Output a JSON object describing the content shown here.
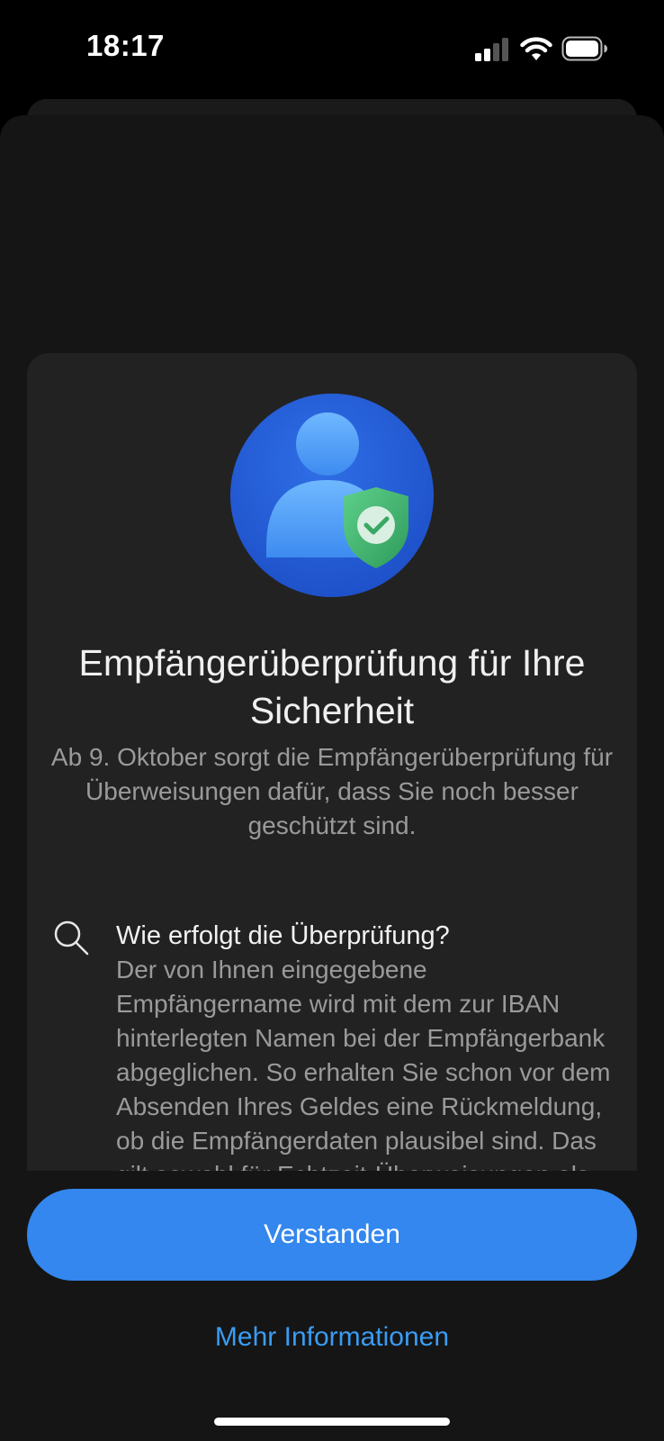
{
  "status_bar": {
    "time": "18:17",
    "icons": [
      "signal-icon",
      "wifi-icon",
      "battery-icon"
    ]
  },
  "hero": {
    "icon": "verified-user-shield-icon"
  },
  "title": "Empfängerüberprüfung für Ihre Sicherheit",
  "subtitle": "Ab 9. Oktober sorgt die Empfängerüberprüfung für Überweisungen dafür, dass Sie noch besser geschützt sind.",
  "info": {
    "icon": "search-icon",
    "heading": "Wie erfolgt die Überprüfung?",
    "body": "Der von Ihnen eingegebene Empfängername wird mit dem zur IBAN hinterlegten Namen bei der Empfängerbank abgeglichen. So erhalten Sie schon vor dem Absenden Ihres Geldes eine Rückmeldung, ob die Empfängerdaten plausibel sind. Das gilt sowohl für Echtzeit-Überweisungen als auch für normale SEPA-Überweisungen."
  },
  "buttons": {
    "primary_label": "Verstanden",
    "secondary_label": "Mehr Informationen"
  },
  "colors": {
    "accent": "#3487ee",
    "link": "#3a9cf4",
    "card_background": "#222222",
    "sheet_background": "#151515"
  }
}
